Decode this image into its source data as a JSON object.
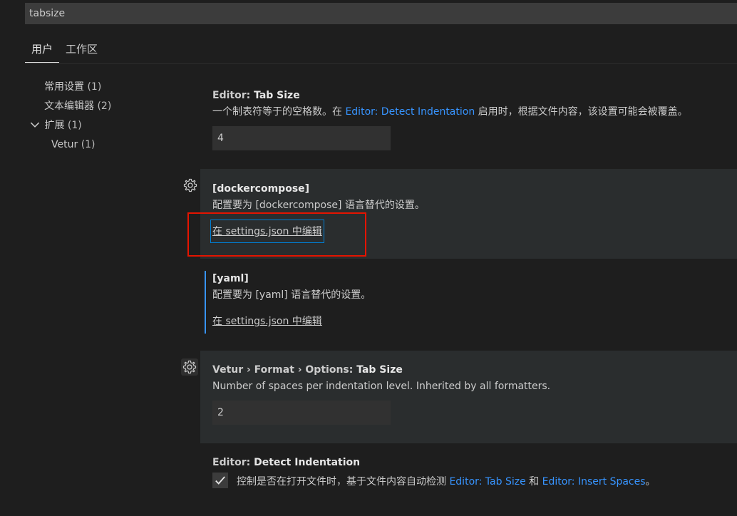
{
  "search": {
    "value": "tabsize"
  },
  "tabs": [
    {
      "label": "用户",
      "active": true
    },
    {
      "label": "工作区",
      "active": false
    }
  ],
  "toc": [
    {
      "label": "常用设置",
      "count": "(1)"
    },
    {
      "label": "文本编辑器",
      "count": "(2)"
    },
    {
      "label": "扩展",
      "count": "(1)",
      "expanded": true
    },
    {
      "label": "Vetur",
      "count": "(1)"
    }
  ],
  "settings": {
    "tab_size": {
      "category": "Editor: ",
      "name": "Tab Size",
      "desc_pre": "一个制表符等于的空格数。在 ",
      "desc_link": "Editor: Detect Indentation",
      "desc_post": " 启用时，根据文件内容，该设置可能会被覆盖。",
      "value": "4"
    },
    "dockercompose": {
      "title": "[dockercompose]",
      "desc": "配置要为 [dockercompose] 语言替代的设置。",
      "edit_link": "在 settings.json 中编辑"
    },
    "yaml": {
      "title": "[yaml]",
      "desc": "配置要为 [yaml] 语言替代的设置。",
      "edit_link": "在 settings.json 中编辑"
    },
    "vetur_tab_size": {
      "category": "Vetur › Format › Options: ",
      "name": "Tab Size",
      "desc": "Number of spaces per indentation level. Inherited by all formatters.",
      "value": "2"
    },
    "detect_indentation": {
      "category": "Editor: ",
      "name": "Detect Indentation",
      "desc_pre": "控制是否在打开文件时，基于文件内容自动检测 ",
      "link1": "Editor: Tab Size",
      "desc_mid": " 和 ",
      "link2": "Editor: Insert Spaces",
      "desc_post": "。",
      "checked": true
    }
  },
  "colors": {
    "background": "#1e1e1e",
    "link": "#3794ff",
    "highlight_box": "#e51400",
    "focus_border": "#007fd4"
  }
}
